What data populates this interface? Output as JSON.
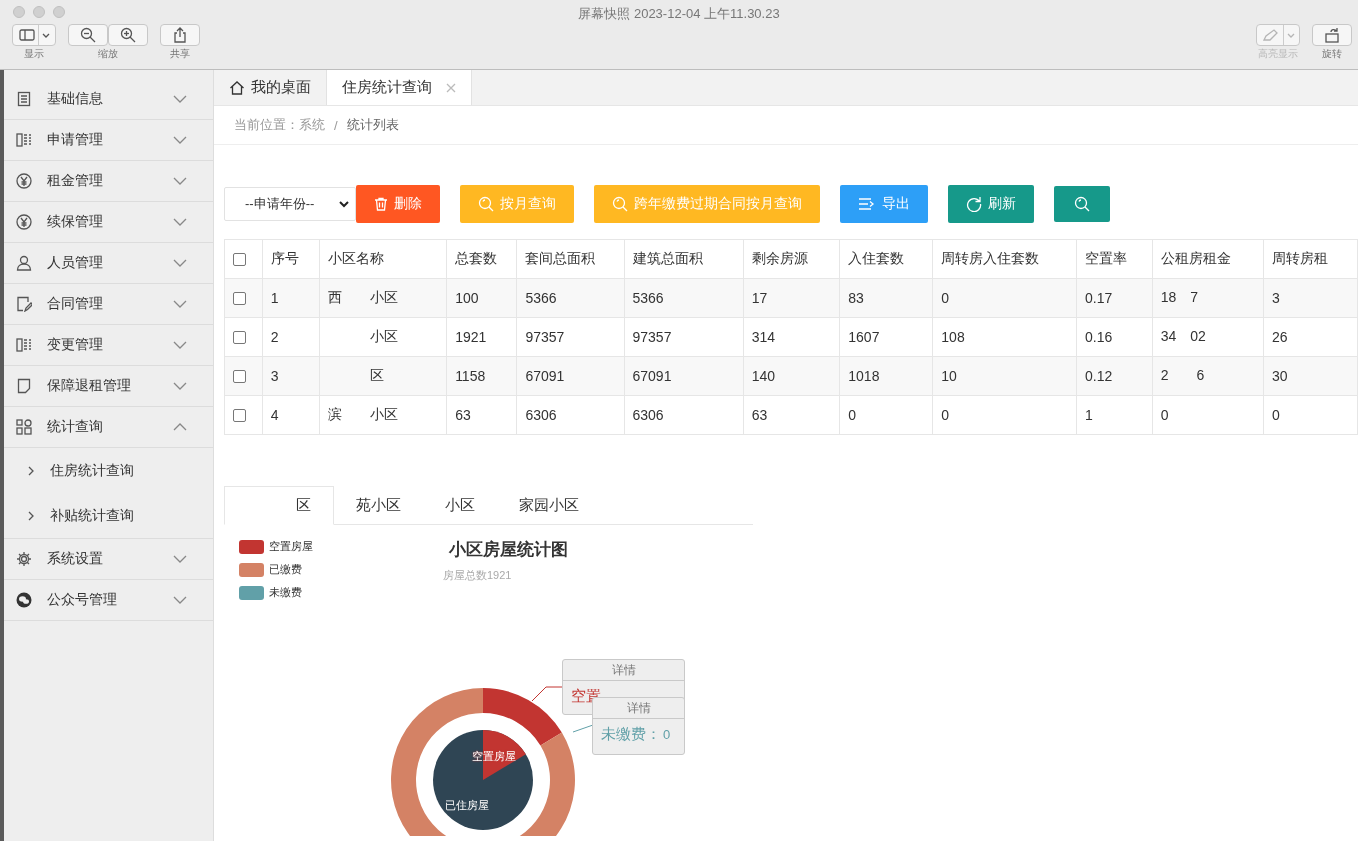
{
  "window": {
    "title": "屏幕快照 2023-12-04 上午11.30.23"
  },
  "toolbar": {
    "left": [
      {
        "kind": "sidebar",
        "label": "显示",
        "disabled": false
      },
      {
        "kind": "zoom",
        "label": "缩放",
        "disabled": false
      },
      {
        "kind": "share",
        "label": "共享",
        "disabled": false
      }
    ],
    "right": [
      {
        "kind": "highlight",
        "label": "高亮显示",
        "disabled": true
      },
      {
        "kind": "rotate",
        "label": "旋转",
        "disabled": false
      }
    ]
  },
  "sidebar": {
    "items": [
      {
        "label": "基础信息",
        "expanded": false
      },
      {
        "label": "申请管理",
        "expanded": false
      },
      {
        "label": "租金管理",
        "expanded": false
      },
      {
        "label": "续保管理",
        "expanded": false
      },
      {
        "label": "人员管理",
        "expanded": false
      },
      {
        "label": "合同管理",
        "expanded": false
      },
      {
        "label": "变更管理",
        "expanded": false
      },
      {
        "label": "保障退租管理",
        "expanded": false
      },
      {
        "label": "统计查询",
        "expanded": true,
        "children": [
          {
            "label": "住房统计查询"
          },
          {
            "label": "补贴统计查询"
          }
        ]
      },
      {
        "label": "系统设置",
        "expanded": false
      },
      {
        "label": "公众号管理",
        "expanded": false
      }
    ]
  },
  "tabs": [
    {
      "label": "我的桌面",
      "kind": "home",
      "selected": false,
      "closable": false
    },
    {
      "label": "住房统计查询",
      "kind": "page",
      "selected": true,
      "closable": true
    }
  ],
  "breadcrumb": {
    "label": "当前位置：",
    "separator": "/",
    "items": [
      "系统",
      "统计列表"
    ]
  },
  "filter": {
    "value": "--申请年份--"
  },
  "buttons": [
    {
      "label": "删除",
      "kind": "delete",
      "color": "#ff5722"
    },
    {
      "label": "按月查询",
      "kind": "search",
      "color": "#ffb822"
    },
    {
      "label": "跨年缴费过期合同按月查询",
      "kind": "search",
      "color": "#ffb822"
    },
    {
      "label": "导出",
      "kind": "export",
      "color": "#2d9ff7"
    },
    {
      "label": "刷新",
      "kind": "refresh",
      "color": "#16998a"
    },
    {
      "kind": "search",
      "color": "#16998a"
    }
  ],
  "table": {
    "header_checked": false,
    "columns": [
      "序号",
      "小区名称",
      "总套数",
      "套间总面积",
      "建筑总面积",
      "剩余房源",
      "入住套数",
      "周转房入住套数",
      "空置率",
      "公租房租金",
      "周转房租"
    ],
    "rows": [
      {
        "checked": false,
        "cells": [
          "1",
          "西　　小区",
          "100",
          "5366",
          "5366",
          "17",
          "83",
          "0",
          "0.17",
          "18　7",
          "3"
        ]
      },
      {
        "checked": false,
        "cells": [
          "2",
          "　　　小区",
          "1921",
          "97357",
          "97357",
          "314",
          "1607",
          "108",
          "0.16",
          "34　02",
          "26"
        ]
      },
      {
        "checked": false,
        "cells": [
          "3",
          "　　　区",
          "1158",
          "67091",
          "67091",
          "140",
          "1018",
          "10",
          "0.12",
          "2　　6",
          "30"
        ]
      },
      {
        "checked": false,
        "cells": [
          "4",
          "滨　　小区",
          "63",
          "6306",
          "6306",
          "63",
          "0",
          "0",
          "1",
          "0",
          "0"
        ]
      }
    ]
  },
  "chart_tabs": [
    {
      "label": "区",
      "selected": true
    },
    {
      "label": "苑小区",
      "selected": false
    },
    {
      "label": "小区",
      "selected": false
    },
    {
      "label": "家园小区",
      "selected": false
    }
  ],
  "legend": [
    {
      "label": "空置房屋",
      "color": "#c23531"
    },
    {
      "label": "已缴费",
      "color": "#d48265"
    },
    {
      "label": "未缴费",
      "color": "#61a0a8"
    }
  ],
  "chart": {
    "title": "小区房屋统计图",
    "subtitle": "房屋总数1921",
    "inner_labels": [
      "空置房屋",
      "已住房屋"
    ]
  },
  "tooltips": [
    {
      "header": "详情",
      "text": "空置",
      "color": "#c23531"
    },
    {
      "header": "详情",
      "text": "未缴费：",
      "value": "0",
      "color": "#61a0a8"
    }
  ]
}
